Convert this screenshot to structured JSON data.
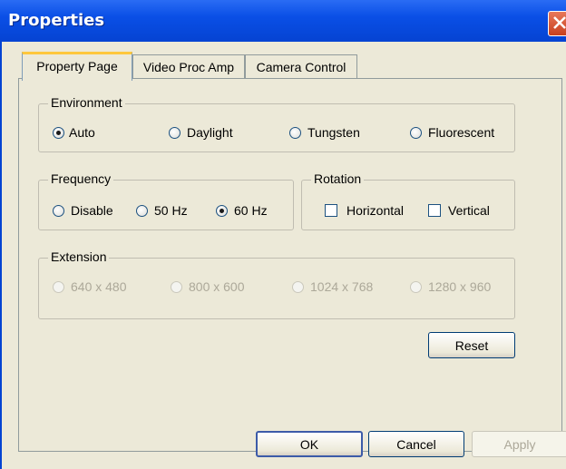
{
  "window": {
    "title": "Properties"
  },
  "tabs": [
    {
      "label": "Property Page",
      "active": true
    },
    {
      "label": "Video Proc Amp",
      "active": false
    },
    {
      "label": "Camera Control",
      "active": false
    }
  ],
  "environment": {
    "legend": "Environment",
    "options": [
      {
        "label": "Auto",
        "checked": true
      },
      {
        "label": "Daylight",
        "checked": false
      },
      {
        "label": "Tungsten",
        "checked": false
      },
      {
        "label": "Fluorescent",
        "checked": false
      }
    ]
  },
  "frequency": {
    "legend": "Frequency",
    "options": [
      {
        "label": "Disable",
        "checked": false
      },
      {
        "label": "50 Hz",
        "checked": false
      },
      {
        "label": "60 Hz",
        "checked": true
      }
    ]
  },
  "rotation": {
    "legend": "Rotation",
    "options": [
      {
        "label": "Horizontal",
        "checked": false
      },
      {
        "label": "Vertical",
        "checked": false
      }
    ]
  },
  "extension": {
    "legend": "Extension",
    "options": [
      {
        "label": "640 x 480",
        "checked": false
      },
      {
        "label": "800 x 600",
        "checked": false
      },
      {
        "label": "1024 x 768",
        "checked": false
      },
      {
        "label": "1280 x 960",
        "checked": false
      }
    ]
  },
  "buttons": {
    "reset": "Reset",
    "ok": "OK",
    "cancel": "Cancel",
    "apply": "Apply"
  },
  "colors": {
    "titlebar": "#0543d2",
    "dialog_bg": "#ece9d8",
    "close_button": "#c8401e",
    "tab_highlight": "#ffc73c"
  }
}
